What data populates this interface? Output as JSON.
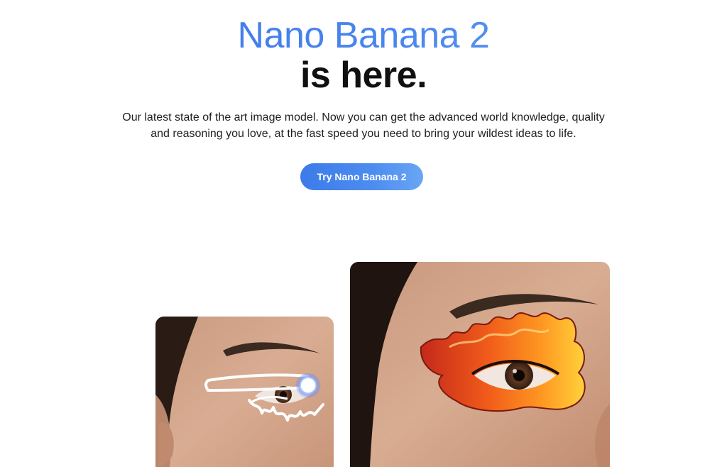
{
  "hero": {
    "title_line1": "Nano Banana 2",
    "title_line2": "is here.",
    "subtitle_line1": "Our latest state of the art image model. Now you can get the advanced world knowledge, quality",
    "subtitle_line2": "and reasoning you love, at the fast speed you need to bring your wildest ideas to life.",
    "cta_label": "Try Nano Banana 2"
  },
  "colors": {
    "title_gradient_start": "#3b73e8",
    "title_gradient_end": "#6aa8f2",
    "title_dark": "#111111",
    "cta_gradient_start": "#3c7be9",
    "cta_gradient_end": "#6aa6f4",
    "background": "#ffffff"
  },
  "images": {
    "left_card": "eye-sketch-photo",
    "right_card": "flame-eye-makeup-photo"
  }
}
